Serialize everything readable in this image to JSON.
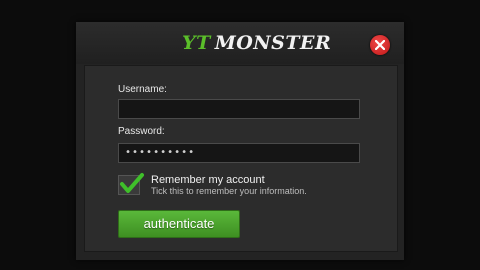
{
  "header": {
    "logo_part1": "YT",
    "logo_part2": "MONSTER"
  },
  "form": {
    "username_label": "Username:",
    "username_value": "",
    "password_label": "Password:",
    "password_value": "••••••••••",
    "remember_label": "Remember my account",
    "remember_hint": "Tick this to remember your information.",
    "remember_checked": true,
    "submit_label": "authenticate"
  },
  "colors": {
    "accent": "#5bbf2a",
    "close": "#d92b2b",
    "background": "#232323"
  },
  "icons": {
    "close": "close-icon",
    "check": "checkmark-icon"
  }
}
